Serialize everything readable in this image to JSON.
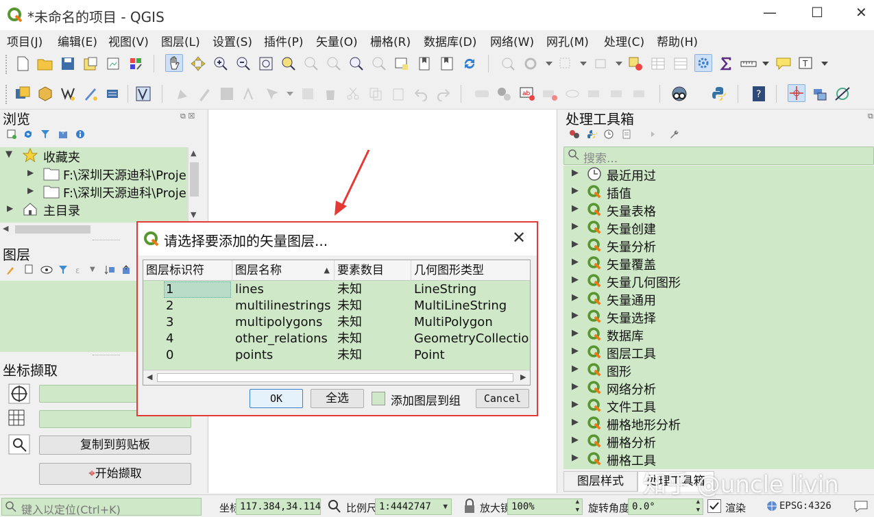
{
  "window": {
    "title": "*未命名的项目 - QGIS"
  },
  "menu": [
    "项目(J)",
    "编辑(E)",
    "视图(V)",
    "图层(L)",
    "设置(S)",
    "插件(P)",
    "矢量(O)",
    "栅格(R)",
    "数据库(D)",
    "网络(W)",
    "网孔(M)",
    "处理(C)",
    "帮助(H)"
  ],
  "browser": {
    "title": "浏览",
    "items": [
      {
        "label": "收藏夹"
      },
      {
        "label": "F:\\深圳天源迪科\\Proje"
      },
      {
        "label": "F:\\深圳天源迪科\\Proje"
      },
      {
        "label": "主目录"
      }
    ]
  },
  "layers_panel": {
    "title": "图层"
  },
  "coord_capture": {
    "title": "坐标撷取",
    "copy_label": "复制到剪贴板",
    "start_label": "开始撷取"
  },
  "toolbox": {
    "title": "处理工具箱",
    "search_placeholder": "搜索...",
    "items": [
      "最近用过",
      "插值",
      "矢量表格",
      "矢量创建",
      "矢量分析",
      "矢量覆盖",
      "矢量几何图形",
      "矢量通用",
      "矢量选择",
      "数据库",
      "图层工具",
      "图形",
      "网络分析",
      "文件工具",
      "栅格地形分析",
      "栅格分析",
      "栅格工具"
    ]
  },
  "bottom_tabs": [
    "图层样式",
    "处理工具箱"
  ],
  "dialog": {
    "title": "请选择要添加的矢量图层...",
    "columns": [
      "图层标识符",
      "图层名称",
      "要素数目",
      "几何图形类型"
    ],
    "rows": [
      [
        "1",
        "lines",
        "未知",
        "LineString"
      ],
      [
        "2",
        "multilinestrings",
        "未知",
        "MultiLineString"
      ],
      [
        "3",
        "multipolygons",
        "未知",
        "MultiPolygon"
      ],
      [
        "4",
        "other_relations",
        "未知",
        "GeometryCollection"
      ],
      [
        "0",
        "points",
        "未知",
        "Point"
      ]
    ],
    "ok_label": "OK",
    "select_all_label": "全选",
    "add_to_group_label": "添加图层到组",
    "cancel_label": "Cancel"
  },
  "statusbar": {
    "locate_placeholder": "键入以定位(Ctrl+K)",
    "coord_label": "坐标",
    "coord_value": "117.384,34.114",
    "scale_label": "比例尺",
    "scale_value": "1:4442747",
    "magnify_label": "放大镜",
    "magnify_value": "100%",
    "rotation_label": "旋转角度",
    "rotation_value": "0.0°",
    "render_label": "渲染",
    "crs": "EPSG:4326"
  },
  "watermark": "知乎 @uncle livin"
}
